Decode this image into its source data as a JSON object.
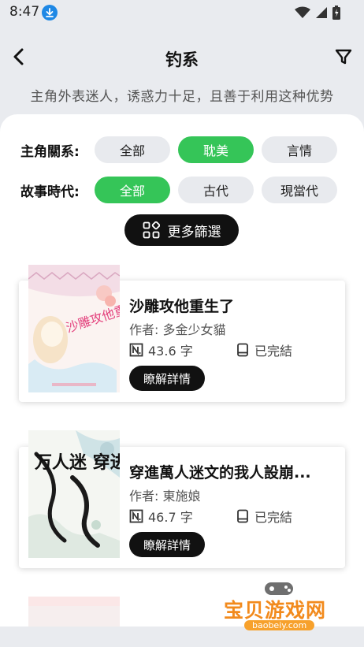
{
  "status_bar": {
    "time": "8:47"
  },
  "header": {
    "title": "钓系",
    "subtitle": "主角外表迷人，诱惑力十足，且善于利用这种优势"
  },
  "filters": {
    "relation": {
      "label": "主角關系:",
      "options": [
        "全部",
        "耽美",
        "言情"
      ],
      "selected": "耽美"
    },
    "era": {
      "label": "故事時代:",
      "options": [
        "全部",
        "古代",
        "現當代"
      ],
      "selected": "全部"
    },
    "more_label": "更多篩選"
  },
  "books": [
    {
      "title": "沙雕攻他重生了",
      "author": "作者: 多金少女貓",
      "words": "43.6 字",
      "status": "已完結",
      "detail_label": "瞭解詳情",
      "cover_text": "沙雕攻他重生了"
    },
    {
      "title": "穿進萬人迷文的我人設崩...",
      "author": "作者: 東施娘",
      "words": "46.7 字",
      "status": "已完結",
      "detail_label": "瞭解詳情",
      "cover_text": "万人迷 穿进 人设崩了"
    }
  ],
  "watermark": {
    "text": "宝贝游戏网",
    "url": "baobeiy.com"
  },
  "colors": {
    "accent": "#35c558",
    "dark": "#111111",
    "chip": "#e8eaee",
    "watermark": "#f28a1c"
  }
}
